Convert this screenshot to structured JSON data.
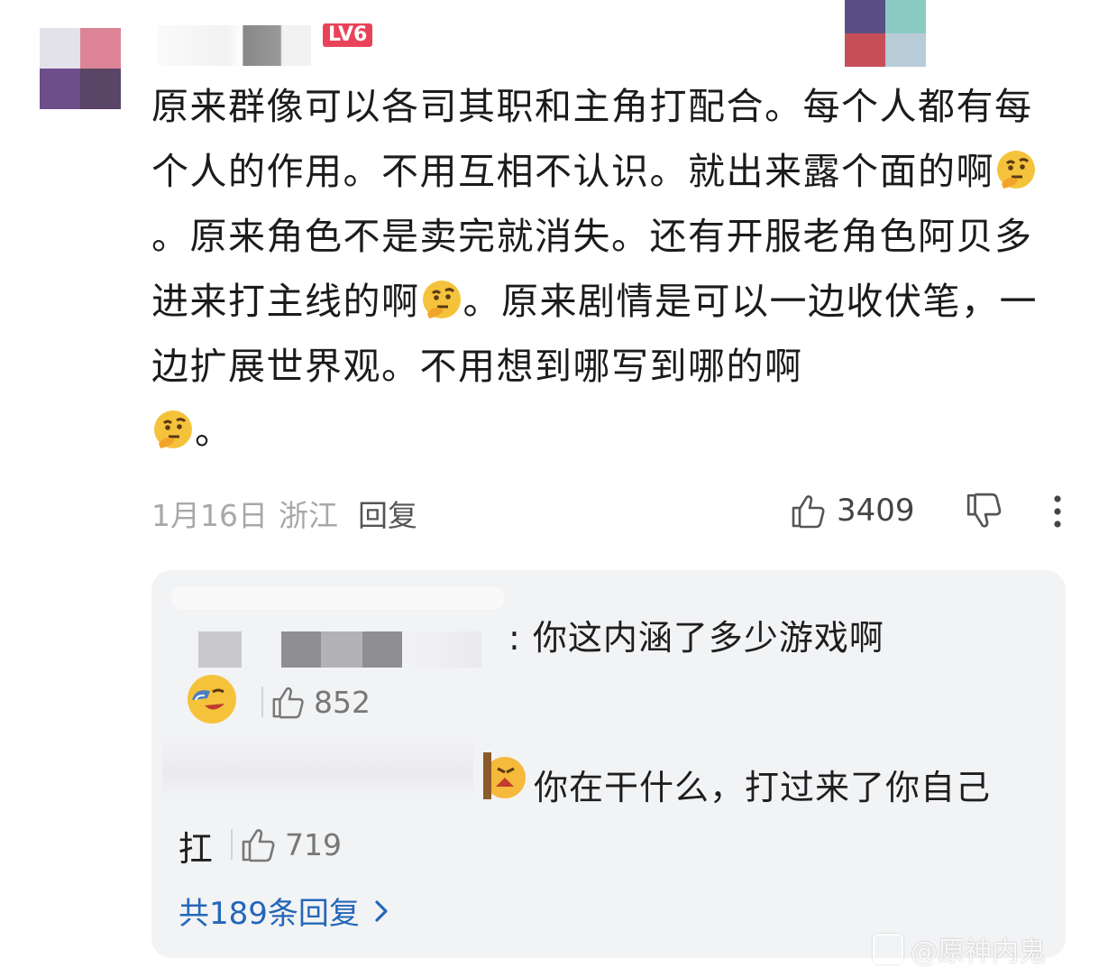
{
  "comment": {
    "level_badge": "LV6",
    "text_parts": [
      "原来群像可以各司其职和主角打配合。每个人都有每个人的作用。不用互相不认识。就出来露个面的啊",
      "。原来角色不是卖完就消失。还有开服老角色阿贝多进来打主线的啊",
      "。原来剧情是可以一边收伏笔，一边扩展世界观。不用想到哪写到哪的啊",
      "。"
    ],
    "date": "1月16日",
    "region": "浙江",
    "reply_label": "回复",
    "like_count": "3409"
  },
  "replies": [
    {
      "text": ": 你这内涵了多少游戏啊",
      "like_count": "852"
    },
    {
      "text": "你在干什么，打过来了你自己",
      "text_tail": "扛",
      "like_count": "719"
    }
  ],
  "more_replies_label": "共189条回复",
  "watermark": "@原神内鬼"
}
